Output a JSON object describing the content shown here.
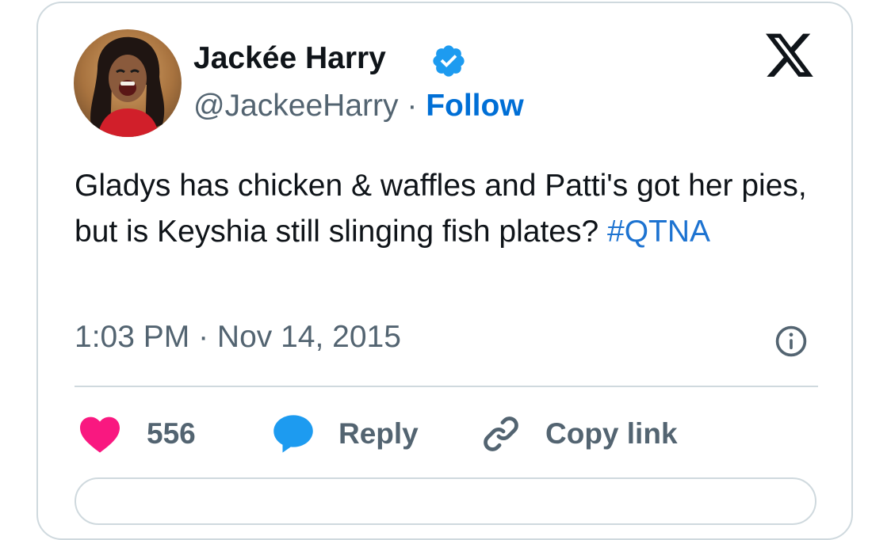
{
  "author": {
    "name": "Jackée Harry",
    "handle": "@JackeeHarry",
    "separator": "·",
    "follow_label": "Follow",
    "verified": true
  },
  "tweet": {
    "text": "Gladys has chicken & waffles and Patti's got her pies, but is Keyshia still slinging fish plates? ",
    "hashtag": "#QTNA",
    "timestamp": "1:03 PM · Nov 14, 2015"
  },
  "actions": {
    "like_count": "556",
    "reply_label": "Reply",
    "copy_link_label": "Copy link"
  },
  "icons": {
    "verified": "verified-badge-icon",
    "brand": "x-logo-icon",
    "info": "info-icon",
    "like": "heart-icon",
    "reply": "speech-bubble-icon",
    "link": "link-icon"
  },
  "colors": {
    "text_primary": "#0f1419",
    "text_secondary": "#536471",
    "follow": "#006fd6",
    "hashtag": "#1d73d1",
    "verified": "#1d9bf0",
    "heart": "#f91880",
    "reply_bubble": "#1d9bf0",
    "border": "#cfd9de"
  }
}
